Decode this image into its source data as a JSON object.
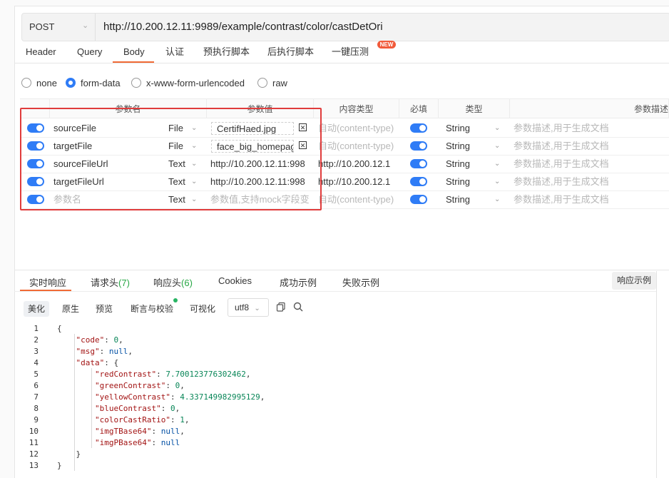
{
  "request": {
    "method": "POST",
    "url": "http://10.200.12.11:9989/example/contrast/color/castDetOri"
  },
  "tabs": [
    "Header",
    "Query",
    "Body",
    "认证",
    "预执行脚本",
    "后执行脚本",
    "一键压测"
  ],
  "active_tab": "Body",
  "new_badge": "NEW",
  "body_types": [
    "none",
    "form-data",
    "x-www-form-urlencoded",
    "raw"
  ],
  "selected_body_type": "form-data",
  "table": {
    "headers": [
      "参数名",
      "参数值",
      "内容类型",
      "必填",
      "类型",
      "参数描述"
    ],
    "rows": [
      {
        "name": "sourceFile",
        "kind": "File",
        "value": "CertifHaed.jpg",
        "content_type": "自动(content-type)",
        "type": "String",
        "desc": "参数描述,用于生成文档"
      },
      {
        "name": "targetFile",
        "kind": "File",
        "value": "face_big_homepage",
        "content_type": "自动(content-type)",
        "type": "String",
        "desc": "参数描述,用于生成文档"
      },
      {
        "name": "sourceFileUrl",
        "kind": "Text",
        "value": "http://10.200.12.11:998",
        "content_type": "http://10.200.12.1",
        "type": "String",
        "desc": "参数描述,用于生成文档"
      },
      {
        "name": "targetFileUrl",
        "kind": "Text",
        "value": "http://10.200.12.11:998",
        "content_type": "http://10.200.12.1",
        "type": "String",
        "desc": "参数描述,用于生成文档"
      },
      {
        "name": "参数名",
        "kind": "Text",
        "value": "参数值,支持mock字段变",
        "content_type": "自动(content-type)",
        "type": "String",
        "desc": "参数描述,用于生成文档"
      }
    ]
  },
  "response": {
    "tabs": [
      "实时响应",
      "请求头",
      "响应头",
      "Cookies",
      "成功示例",
      "失败示例"
    ],
    "req_headers_count": "(7)",
    "resp_headers_count": "(6)",
    "example_button": "响应示例",
    "view_tabs": [
      "美化",
      "原生",
      "预览",
      "断言与校验",
      "可视化"
    ],
    "encoding": "utf8",
    "code_lines": [
      "{",
      "    \"code\": 0,",
      "    \"msg\": null,",
      "    \"data\": {",
      "        \"redContrast\": 7.700123776302462,",
      "        \"greenContrast\": 0,",
      "        \"yellowContrast\": 4.337149982995129,",
      "        \"blueContrast\": 0,",
      "        \"colorCastRatio\": 1,",
      "        \"imgTBase64\": null,",
      "        \"imgPBase64\": null",
      "    }",
      "}"
    ]
  },
  "icons": {
    "copy": "copy-icon",
    "search": "search-icon"
  },
  "colors": {
    "accent": "#f06a35",
    "primary": "#2f7cf6",
    "highlight": "#e03c3c",
    "badge": "#f15a3a"
  }
}
